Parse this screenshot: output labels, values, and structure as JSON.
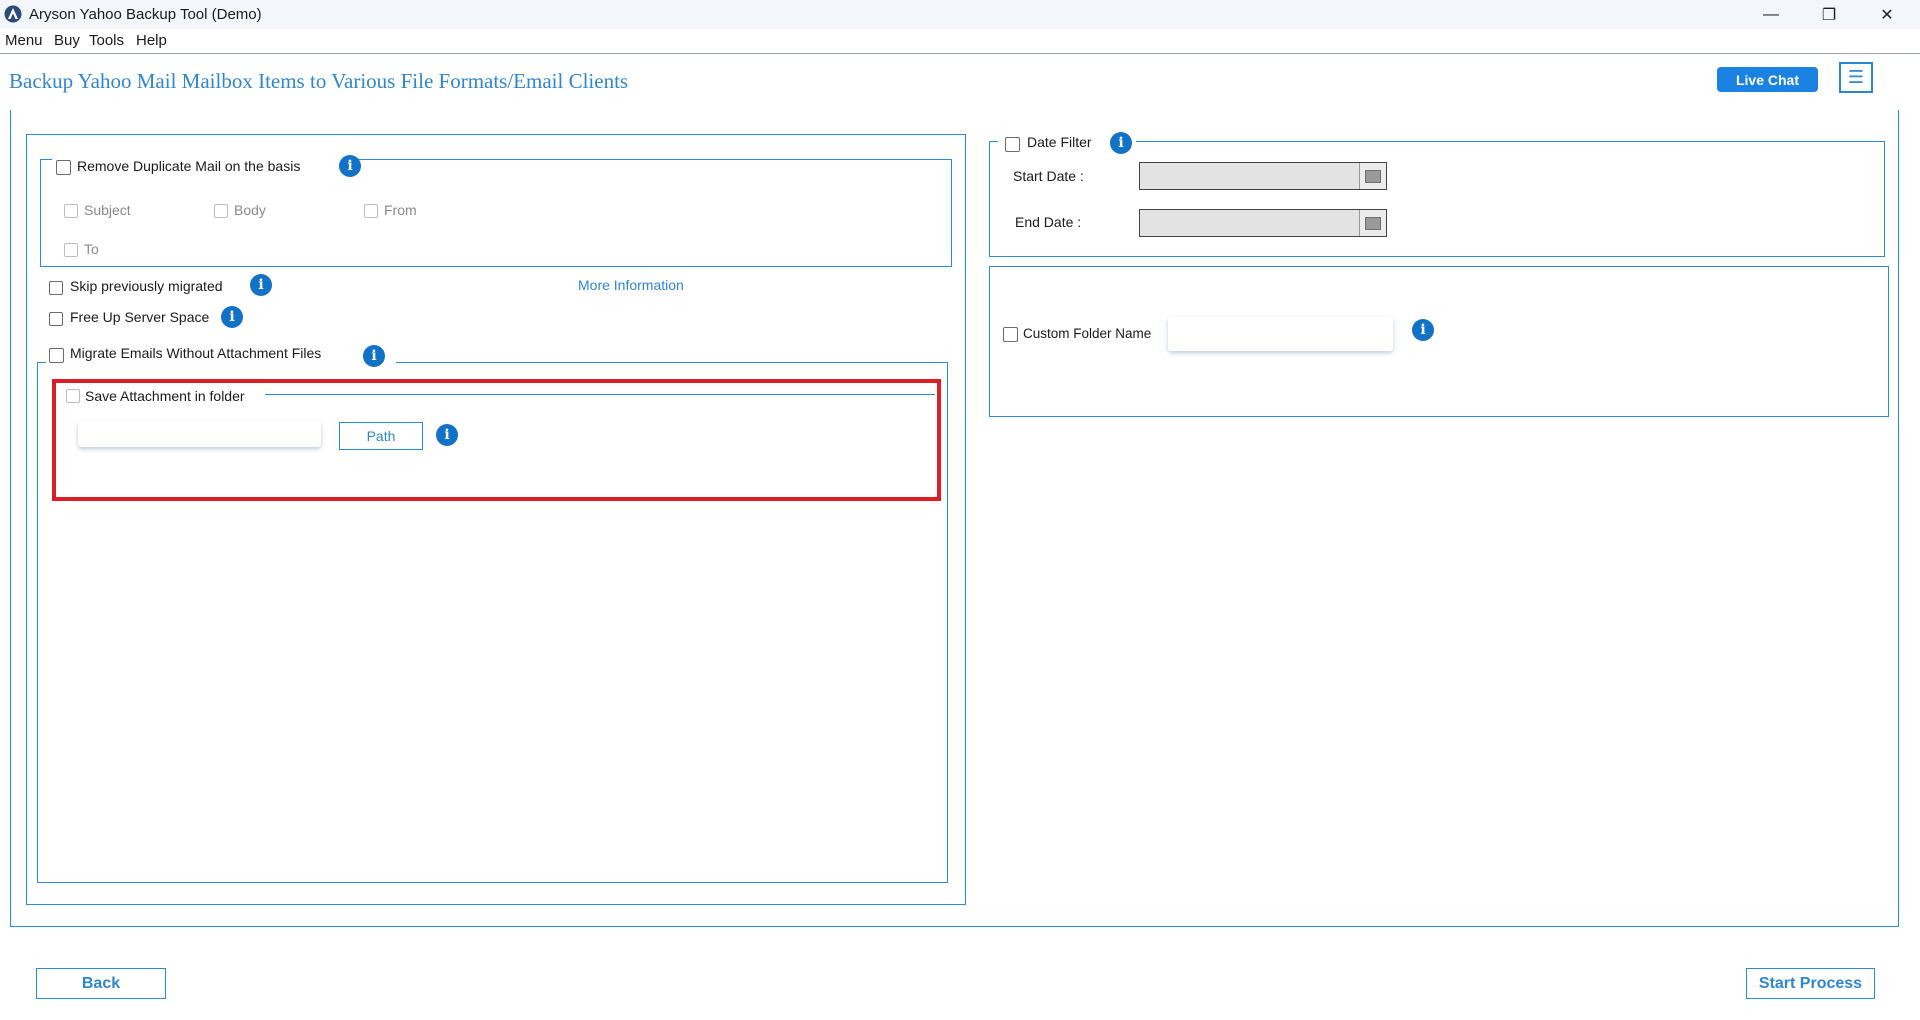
{
  "window": {
    "title": "Aryson Yahoo Backup Tool (Demo)",
    "minimize_glyph": "—",
    "maximize_glyph": "❐",
    "close_glyph": "✕"
  },
  "menu": {
    "items": [
      "Menu",
      "Buy",
      "Tools",
      "Help"
    ]
  },
  "header": {
    "title": "Backup Yahoo Mail Mailbox Items to Various File Formats/Email Clients",
    "live_chat_label": "Live Chat",
    "hamburger_glyph": "☰"
  },
  "left": {
    "remove_duplicate": {
      "label": "Remove Duplicate Mail on the basis",
      "checked": false,
      "options": [
        "Subject",
        "Body",
        "From",
        "To"
      ]
    },
    "skip_previously_migrated": "Skip previously migrated",
    "more_information_link": "More Information",
    "free_up_server_space": "Free Up Server Space",
    "migrate_without_attachments": "Migrate Emails Without Attachment Files",
    "save_attachment_in_folder": "Save Attachment in folder",
    "path_input_value": "",
    "path_button_label": "Path"
  },
  "right": {
    "date_filter": {
      "label": "Date Filter",
      "start_label": "Start Date :",
      "end_label": "End Date :",
      "start_value": "",
      "end_value": ""
    },
    "custom_folder": {
      "label": "Custom Folder Name",
      "value": ""
    }
  },
  "footer": {
    "back_label": "Back",
    "start_label": "Start Process"
  },
  "colors": {
    "accent": "#2d8ad8",
    "info_icon": "#1172c6",
    "highlight": "#dc1f26",
    "live_chat_bg": "#1a82e2"
  },
  "icons": {
    "info": "info-icon",
    "calendar": "calendar-icon",
    "app": "app-logo-icon",
    "info_glyph": "i"
  }
}
